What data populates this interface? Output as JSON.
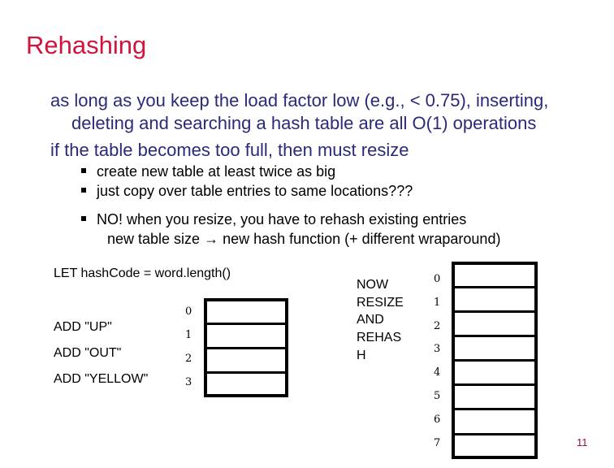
{
  "slide": {
    "title": "Rehashing",
    "points": [
      "as long as you keep the load factor low (e.g., < 0.75), inserting,",
      "deleting and searching a hash table are all O(1) operations",
      "if the table becomes too full, then must resize"
    ],
    "subpoints": [
      "create new table at least twice as big",
      "just copy over table entries to same locations???",
      "NO! when you resize, you have to rehash existing entries",
      "new table size → new hash function (+ different wraparound)"
    ],
    "left_diagram": {
      "heading": "LET hashCode = word.length()",
      "ops": [
        "ADD \"UP\"",
        "ADD \"OUT\"",
        "ADD \"YELLOW\""
      ],
      "indices": [
        "0",
        "1",
        "2",
        "3"
      ]
    },
    "right_diagram": {
      "label_lines": [
        "NOW",
        "RESIZE",
        "AND",
        "REHAS",
        "H"
      ],
      "indices": [
        "0",
        "1",
        "2",
        "3",
        "4",
        "5",
        "6",
        "7"
      ]
    },
    "page_number": "11"
  }
}
